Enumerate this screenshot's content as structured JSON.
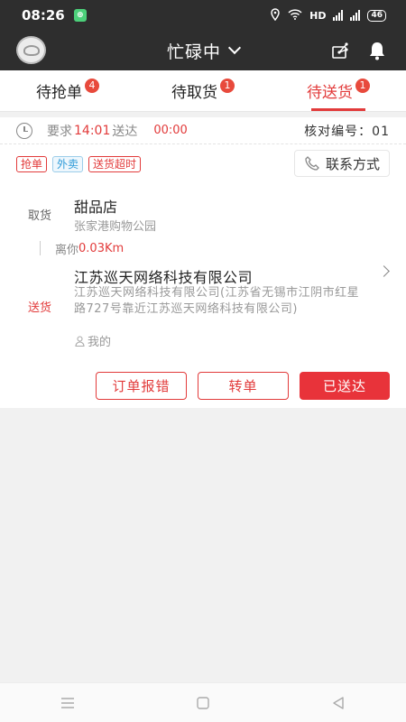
{
  "status_bar": {
    "time": "08:26",
    "network": "HD",
    "battery": "46"
  },
  "header": {
    "title": "忙碌中"
  },
  "tabs": [
    {
      "label": "待抢单",
      "badge": "4"
    },
    {
      "label": "待取货",
      "badge": "1"
    },
    {
      "label": "待送货",
      "badge": "1"
    }
  ],
  "order": {
    "required_prefix": "要求",
    "required_time": "14:01",
    "required_suffix": "送达",
    "countdown": "00:00",
    "verify_label": "核对编号：",
    "verify_code": "01",
    "tags": [
      "抢单",
      "外卖",
      "送货超时"
    ],
    "contact_label": "联系方式",
    "pickup": {
      "label": "取货",
      "name": "甜品店",
      "address": "张家港购物公园"
    },
    "distance_prefix": "离你",
    "distance_value": "0.03Km",
    "delivery": {
      "label": "送货",
      "name": "江苏巡天网络科技有限公司",
      "address": "江苏巡天网络科技有限公司(江苏省无锡市江阴市红星路727号靠近江苏巡天网络科技有限公司)",
      "owner": "我的"
    },
    "buttons": {
      "report": "订单报错",
      "transfer": "转单",
      "delivered": "已送达"
    }
  },
  "colors": {
    "accent": "#e23b3b",
    "header_bg": "#2e2e2e",
    "tag_blue": "#2f9bd8"
  }
}
